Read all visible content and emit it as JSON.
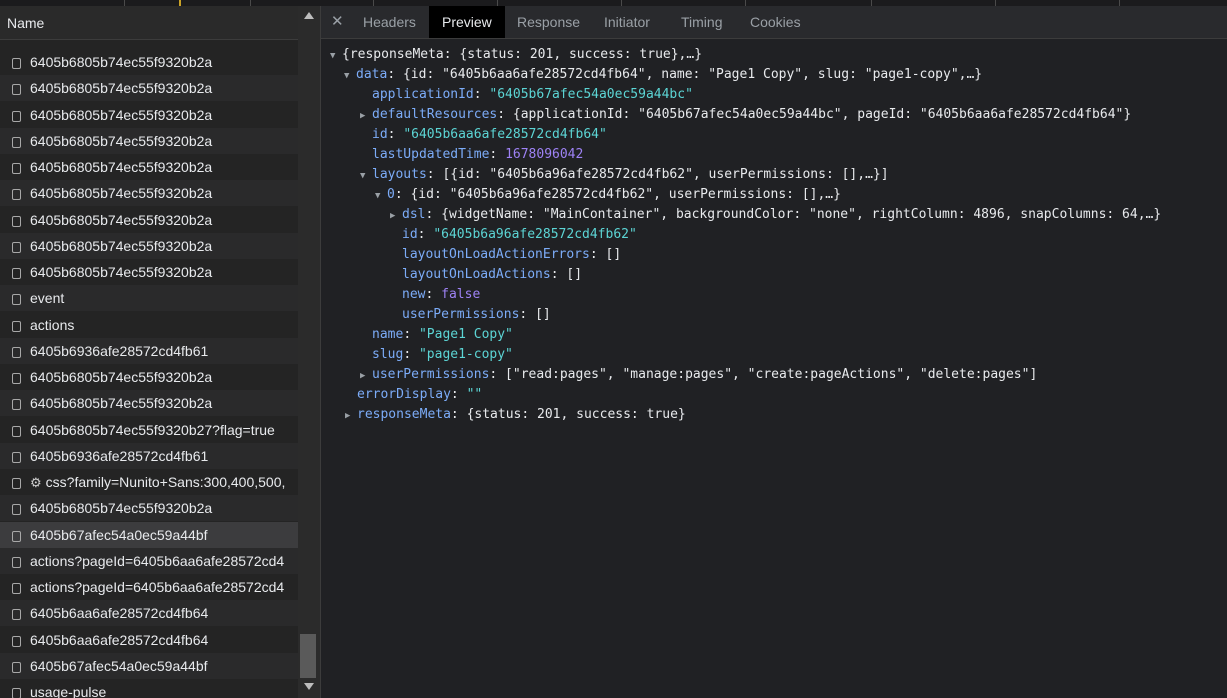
{
  "list": {
    "header": "Name",
    "items": [
      {
        "label": "6405b6805b74ec55f9320b2a"
      },
      {
        "label": "6405b6805b74ec55f9320b2a"
      },
      {
        "label": "6405b6805b74ec55f9320b2a"
      },
      {
        "label": "6405b6805b74ec55f9320b2a"
      },
      {
        "label": "6405b6805b74ec55f9320b2a"
      },
      {
        "label": "6405b6805b74ec55f9320b2a"
      },
      {
        "label": "6405b6805b74ec55f9320b2a"
      },
      {
        "label": "6405b6805b74ec55f9320b2a"
      },
      {
        "label": "6405b6805b74ec55f9320b2a"
      },
      {
        "label": "event"
      },
      {
        "label": "actions"
      },
      {
        "label": "6405b6936afe28572cd4fb61"
      },
      {
        "label": "6405b6805b74ec55f9320b2a"
      },
      {
        "label": "6405b6805b74ec55f9320b2a"
      },
      {
        "label": "6405b6805b74ec55f9320b27?flag=true"
      },
      {
        "label": "6405b6936afe28572cd4fb61"
      },
      {
        "label": "css?family=Nunito+Sans:300,400,500,",
        "icon": "gear-icon"
      },
      {
        "label": "6405b6805b74ec55f9320b2a"
      },
      {
        "label": "6405b67afec54a0ec59a44bf",
        "selected": true
      },
      {
        "label": "actions?pageId=6405b6aa6afe28572cd4"
      },
      {
        "label": "actions?pageId=6405b6aa6afe28572cd4"
      },
      {
        "label": "6405b6aa6afe28572cd4fb64"
      },
      {
        "label": "6405b6aa6afe28572cd4fb64"
      },
      {
        "label": "6405b67afec54a0ec59a44bf"
      },
      {
        "label": "usage-pulse"
      }
    ]
  },
  "tabs": {
    "close": "✕",
    "items": [
      "Headers",
      "Preview",
      "Response",
      "Initiator",
      "Timing",
      "Cookies"
    ],
    "active": "Preview"
  },
  "preview": {
    "l1": "{responseMeta: {status: 201, success: true},…}",
    "l2_key": "data",
    "l2_rest": ": {id: \"6405b6aa6afe28572cd4fb64\", name: \"Page1 Copy\", slug: \"page1-copy\",…}",
    "l3_key": "applicationId",
    "l3_val": "\"6405b67afec54a0ec59a44bc\"",
    "l4_key": "defaultResources",
    "l4_rest": ": {applicationId: \"6405b67afec54a0ec59a44bc\", pageId: \"6405b6aa6afe28572cd4fb64\"}",
    "l5_key": "id",
    "l5_val": "\"6405b6aa6afe28572cd4fb64\"",
    "l6_key": "lastUpdatedTime",
    "l6_val": "1678096042",
    "l7_key": "layouts",
    "l7_rest": ": [{id: \"6405b6a96afe28572cd4fb62\", userPermissions: [],…}]",
    "l8_key": "0",
    "l8_rest": ": {id: \"6405b6a96afe28572cd4fb62\", userPermissions: [],…}",
    "l9_key": "dsl",
    "l9_rest": ": {widgetName: \"MainContainer\", backgroundColor: \"none\", rightColumn: 4896, snapColumns: 64,…}",
    "l10_key": "id",
    "l10_val": "\"6405b6a96afe28572cd4fb62\"",
    "l11_key": "layoutOnLoadActionErrors",
    "l11_val": "[]",
    "l12_key": "layoutOnLoadActions",
    "l12_val": "[]",
    "l13_key": "new",
    "l13_val": "false",
    "l14_key": "userPermissions",
    "l14_val": "[]",
    "l15_key": "name",
    "l15_val": "\"Page1 Copy\"",
    "l16_key": "slug",
    "l16_val": "\"page1-copy\"",
    "l17_key": "userPermissions",
    "l17_rest": ": [\"read:pages\", \"manage:pages\", \"create:pageActions\", \"delete:pages\"]",
    "l18_key": "errorDisplay",
    "l18_val": "\"\"",
    "l19_key": "responseMeta",
    "l19_rest": ": {status: 201, success: true}"
  }
}
